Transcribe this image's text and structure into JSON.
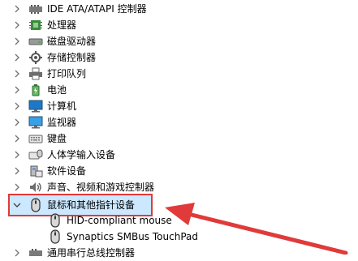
{
  "tree": {
    "items": [
      {
        "label": "IDE ATA/ATAPI 控制器",
        "icon": "ide-controller-icon",
        "expanded": false
      },
      {
        "label": "处理器",
        "icon": "processor-icon",
        "expanded": false
      },
      {
        "label": "磁盘驱动器",
        "icon": "disk-drive-icon",
        "expanded": false
      },
      {
        "label": "存储控制器",
        "icon": "storage-controller-icon",
        "expanded": false
      },
      {
        "label": "打印队列",
        "icon": "printer-icon",
        "expanded": false
      },
      {
        "label": "电池",
        "icon": "battery-icon",
        "expanded": false
      },
      {
        "label": "计算机",
        "icon": "computer-icon",
        "expanded": false
      },
      {
        "label": "监视器",
        "icon": "monitor-icon",
        "expanded": false
      },
      {
        "label": "键盘",
        "icon": "keyboard-icon",
        "expanded": false
      },
      {
        "label": "人体学输入设备",
        "icon": "hid-icon",
        "expanded": false
      },
      {
        "label": "软件设备",
        "icon": "software-device-icon",
        "expanded": false
      },
      {
        "label": "声音、视频和游戏控制器",
        "icon": "sound-icon",
        "expanded": false
      },
      {
        "label": "鼠标和其他指针设备",
        "icon": "mouse-icon",
        "expanded": true,
        "selected": true,
        "children": [
          {
            "label": "HID-compliant mouse",
            "icon": "mouse-icon"
          },
          {
            "label": "Synaptics SMBus TouchPad",
            "icon": "mouse-icon"
          }
        ]
      },
      {
        "label": "通用串行总线控制器",
        "icon": "usb-controller-icon",
        "expanded": false
      }
    ]
  },
  "colors": {
    "selection": "#cce8ff",
    "highlight_box": "#e03a3a",
    "annotation_arrow": "#e03a3a"
  }
}
